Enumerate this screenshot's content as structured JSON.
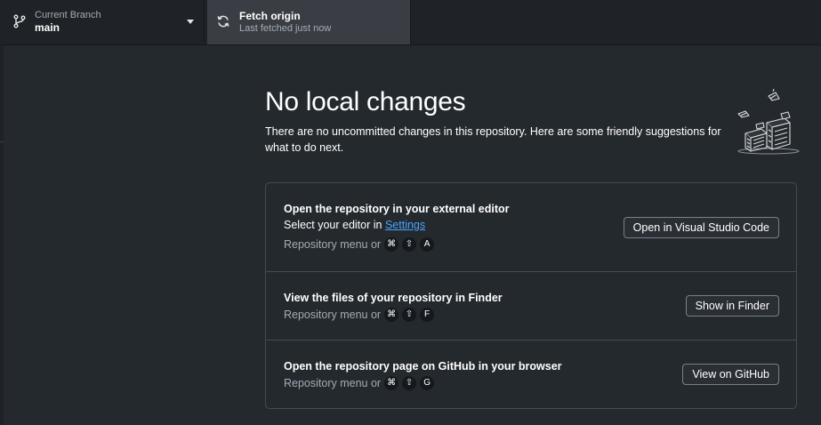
{
  "toolbar": {
    "branch": {
      "label": "Current Branch",
      "value": "main"
    },
    "fetch": {
      "title": "Fetch origin",
      "subtitle": "Last fetched just now"
    }
  },
  "main": {
    "heading": "No local changes",
    "subtext": "There are no uncommitted changes in this repository. Here are some friendly suggestions for what to do next."
  },
  "suggestions": [
    {
      "title": "Open the repository in your external editor",
      "line_prefix": "Select your editor in ",
      "line_link": "Settings",
      "hint_prefix": "Repository menu or",
      "keys": [
        "⌘",
        "⇧",
        "A"
      ],
      "button": "Open in Visual Studio Code"
    },
    {
      "title": "View the files of your repository in Finder",
      "hint_prefix": "Repository menu or",
      "keys": [
        "⌘",
        "⇧",
        "F"
      ],
      "button": "Show in Finder"
    },
    {
      "title": "Open the repository page on GitHub in your browser",
      "hint_prefix": "Repository menu or",
      "keys": [
        "⌘",
        "⇧",
        "G"
      ],
      "button": "View on GitHub"
    }
  ],
  "icons": {
    "branch": "git-branch-icon",
    "fetch": "sync-icon",
    "caret": "triangle-down-icon",
    "illustration": "paper-stacks-illustration"
  },
  "colors": {
    "background": "#24292e",
    "toolbar": "#1f2328",
    "link": "#4aa3ff",
    "muted_text": "#a4abb3",
    "border": "#444b53"
  }
}
